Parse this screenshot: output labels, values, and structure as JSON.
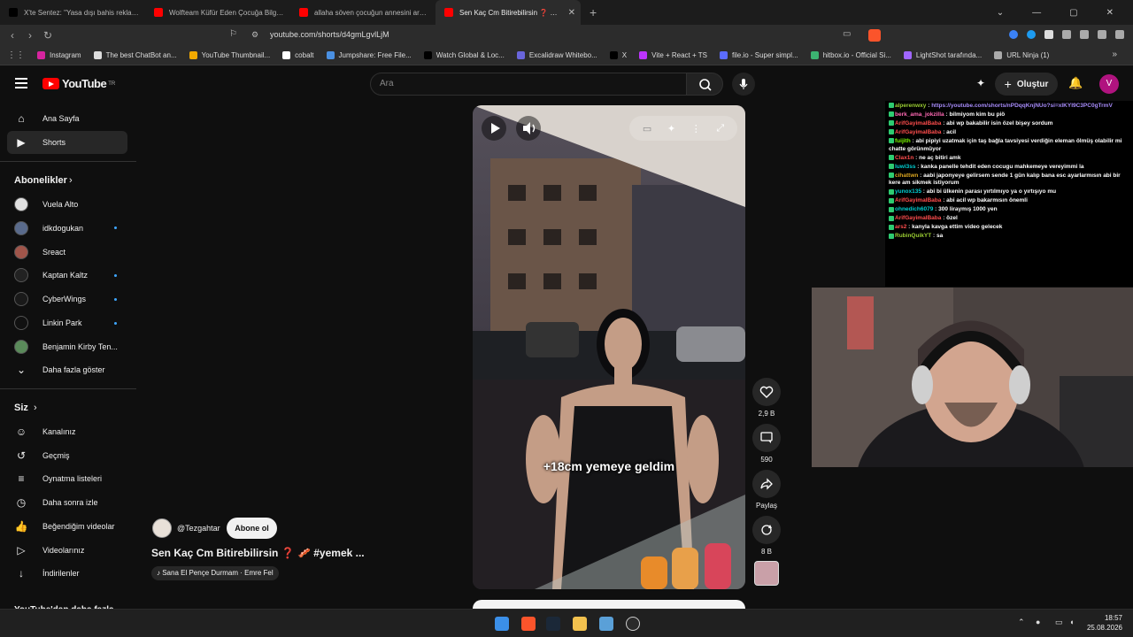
{
  "browser": {
    "tabs": [
      {
        "title": "X'te Sentez: \"Yasa dışı bahis reklamı...",
        "icon": "x-logo-icon",
        "color": "#000000",
        "active": false
      },
      {
        "title": "Wolfteam Küfür Eden Çocuğa Bilgisa...",
        "icon": "youtube-icon",
        "color": "#ff0000",
        "active": false
      },
      {
        "title": "allaha söven çocuğun annesini aradı...",
        "icon": "youtube-icon",
        "color": "#ff0000",
        "active": false
      },
      {
        "title": "Sen Kaç Cm Bitirebilirsin ❓ 🥓 ...",
        "icon": "youtube-icon",
        "color": "#ff0000",
        "active": true
      }
    ],
    "url": "youtube.com/shorts/d4gmLgvlLjM",
    "bookmarks": [
      {
        "label": "Instagram",
        "color": "#d6249f"
      },
      {
        "label": "The best ChatBot an...",
        "color": "#dddddd"
      },
      {
        "label": "YouTube Thumbnail...",
        "color": "#f2a900"
      },
      {
        "label": "cobalt",
        "color": "#ffffff"
      },
      {
        "label": "Jumpshare: Free File...",
        "color": "#4a90e2"
      },
      {
        "label": "Watch Global & Loc...",
        "color": "#000000"
      },
      {
        "label": "Excalidraw Whitebo...",
        "color": "#6965db"
      },
      {
        "label": "X",
        "color": "#000000"
      },
      {
        "label": "Vite + React + TS",
        "color": "#bd34fe"
      },
      {
        "label": "file.io - Super simpl...",
        "color": "#5b6cff"
      },
      {
        "label": "hitbox.io - Official Si...",
        "color": "#3cb371"
      },
      {
        "label": "LightShot tarafında...",
        "color": "#a066ff"
      },
      {
        "label": "URL Ninja (1)",
        "color": "#aaaaaa"
      }
    ]
  },
  "youtube": {
    "logo": "YouTube",
    "logo_sup": "TR",
    "search_placeholder": "Ara",
    "create_label": "Oluştur",
    "avatar_letter": "V",
    "sidebar": {
      "main": [
        {
          "label": "Ana Sayfa",
          "icon": "home-icon"
        },
        {
          "label": "Shorts",
          "icon": "shorts-icon",
          "active": true
        }
      ],
      "subscriptions_header": "Abonelikler",
      "subscriptions": [
        {
          "label": "Vuela Alto",
          "color": "#e0e0e0",
          "new": false
        },
        {
          "label": "idkdogukan",
          "color": "#5a6b8c",
          "new": true
        },
        {
          "label": "Sreact",
          "color": "#a0554a",
          "new": false
        },
        {
          "label": "Kaptan Kaltz",
          "color": "#222222",
          "new": true
        },
        {
          "label": "CyberWings",
          "color": "#1a1a1a",
          "new": true
        },
        {
          "label": "Linkin Park",
          "color": "#111111",
          "new": true
        },
        {
          "label": "Benjamin Kirby Ten...",
          "color": "#5a8a5a",
          "new": false
        }
      ],
      "show_more": "Daha fazla göster",
      "you_header": "Siz",
      "you_items": [
        {
          "label": "Kanalınız",
          "icon": "channel-icon"
        },
        {
          "label": "Geçmiş",
          "icon": "history-icon"
        },
        {
          "label": "Oynatma listeleri",
          "icon": "playlists-icon"
        },
        {
          "label": "Daha sonra izle",
          "icon": "watch-later-icon"
        },
        {
          "label": "Beğendiğim videolar",
          "icon": "liked-icon"
        },
        {
          "label": "Videolarınız",
          "icon": "your-videos-icon"
        },
        {
          "label": "İndirilenler",
          "icon": "downloads-icon"
        }
      ],
      "more_header": "YouTube'dan daha fazla"
    },
    "short": {
      "caption": "+18cm yemeye geldim",
      "channel": "@Tezgahtar",
      "subscribe_label": "Abone ol",
      "title": "Sen Kaç Cm Bitirebilirsin ❓ 🥓 #yemek ...",
      "music": "♪ Sana El Pençe Durmam · Emre Fel",
      "likes": "2,9 B",
      "comments": "590",
      "share_label": "Paylaş",
      "remix": "8 B"
    }
  },
  "chat": [
    {
      "user": "alperenwxy",
      "color": "#9acd32",
      "msg": "https://youtube.com/shorts/nPDqqKnjNUo?si=xlKYI9C3PC0gTrmV",
      "msgColor": "#a78bfa"
    },
    {
      "user": "berk_ama_jokzilla",
      "color": "#ff69b4",
      "msg": "bilmiyom kim bu piö"
    },
    {
      "user": "ArifGayimalBaba",
      "color": "#ff4d4d",
      "msg": "abi wp bakabilir isin özel bişey sordum"
    },
    {
      "user": "ArifGayimalBaba",
      "color": "#ff4d4d",
      "msg": "acil"
    },
    {
      "user": "fuijith",
      "color": "#7cfc00",
      "msg": "abi pipiyi uzatmak için taş bağla tavsiyesi verdiğin eleman ölmüş olabilir mi chatte görünmüyor"
    },
    {
      "user": "Clax1n",
      "color": "#ff4d4d",
      "msg": "ne aç bitiri amk"
    },
    {
      "user": "luwi3ss",
      "color": "#00ced1",
      "msg": "kanka panelle tehdit eden cocugu mahkemeye vereyimmi la"
    },
    {
      "user": "cihattwn",
      "color": "#daa520",
      "msg": "aabi japonyeye gelirsem sende 1 gün kalıp bana esc ayarlarmısın abi bir kere am sikmek istiyorum"
    },
    {
      "user": "yunox135",
      "color": "#00ced1",
      "msg": "abi bi ülkenin parası yırtılmıyo ya o yırtışıyo mu"
    },
    {
      "user": "ArifGayimalBaba",
      "color": "#ff4d4d",
      "msg": "abi acil wp bakarmısın önemli"
    },
    {
      "user": "ohnedich6079",
      "color": "#00ced1",
      "msg": "300 liraymış 1000 yen"
    },
    {
      "user": "ArifGayimalBaba",
      "color": "#ff4d4d",
      "msg": "özel"
    },
    {
      "user": "ars2",
      "color": "#ff4d4d",
      "msg": "kanyla kavga ettim video gelecek"
    },
    {
      "user": "RubinQuikYT",
      "color": "#9acd32",
      "msg": "sa"
    }
  ],
  "taskbar": {
    "time": "18:57",
    "date": "25.08.2026"
  }
}
